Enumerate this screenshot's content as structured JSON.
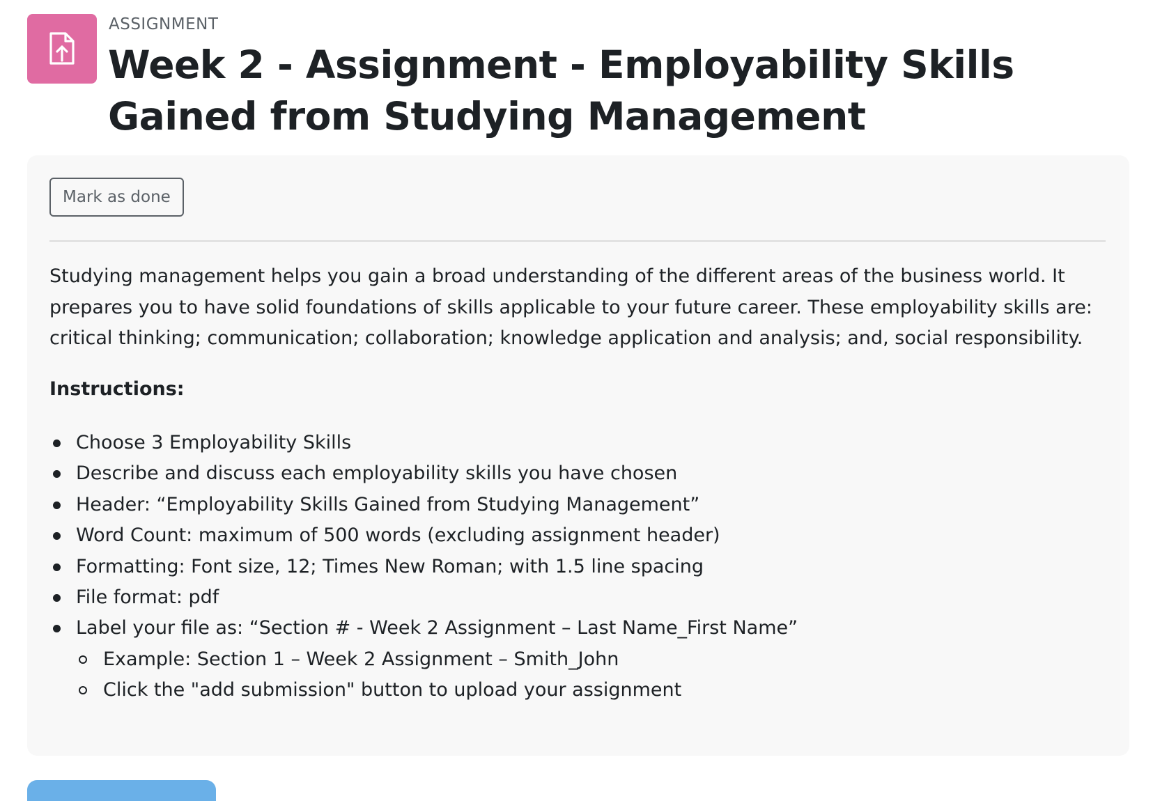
{
  "header": {
    "icon": "file-upload-icon",
    "icon_color": "#e06ba2",
    "type_label": "ASSIGNMENT",
    "title": "Week 2 - Assignment - Employability Skills Gained from Studying Management"
  },
  "actions": {
    "mark_done_label": "Mark as done"
  },
  "content": {
    "description": "Studying management helps you gain a broad understanding of the different areas of the business world. It prepares you to have solid foundations of skills applicable to your future career. These employability skills are: critical thinking; communication; collaboration; knowledge application and analysis; and, social responsibility.",
    "instructions_heading": "Instructions:",
    "instructions": [
      "Choose 3 Employability Skills",
      "Describe and discuss each employability skills you have chosen",
      "Header: “Employability Skills Gained from Studying Management”",
      "Word Count: maximum of 500 words (excluding assignment header)",
      "Formatting: Font size, 12; Times New Roman; with 1.5 line spacing",
      "File format: pdf",
      "Label your file as: “Section # - Week 2 Assignment – Last Name_First Name”"
    ],
    "sub_instructions": [
      "Example: Section 1 – Week 2 Assignment – Smith_John",
      "Click the \"add submission\" button to upload your assignment"
    ]
  },
  "colors": {
    "accent_blue": "#6ab0e8",
    "panel_background": "#f8f8f8"
  }
}
